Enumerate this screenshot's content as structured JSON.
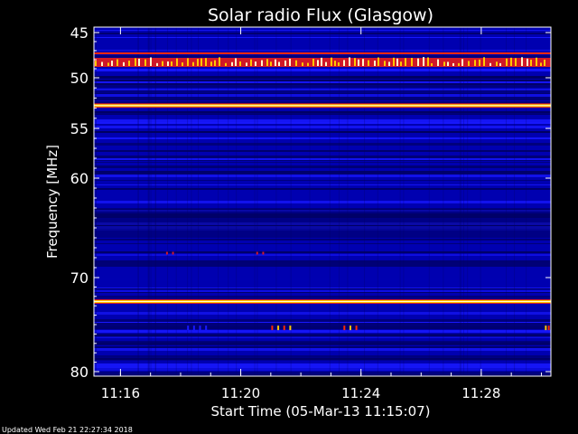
{
  "updated_text": "Updated Wed Feb 21 22:27:34 2018",
  "chart_data": {
    "type": "heatmap",
    "title": "Solar radio Flux (Glasgow)",
    "xlabel": "Start Time (05-Mar-13 11:15:07)",
    "ylabel": "Frequency [MHz]",
    "x_start": "11:15:07",
    "x_ticks": [
      "11:16",
      "11:20",
      "11:24",
      "11:28"
    ],
    "x_tick_minutes": [
      0.883,
      4.883,
      8.883,
      12.883
    ],
    "x_range_minutes": [
      0,
      15.2
    ],
    "y_ticks": [
      45,
      50,
      55,
      60,
      70,
      80
    ],
    "ylim": [
      44.7,
      80.3
    ],
    "y_axis_inverted": true,
    "y_axis_nonlinear": true,
    "colormap": [
      "#000060",
      "#0000b0",
      "#1818ff",
      "#d01828",
      "#ff2800",
      "#ffc800",
      "#fff8d0"
    ],
    "background_level": "blue",
    "features": [
      {
        "name": "dashed spike band",
        "freq_range_mhz": [
          47.8,
          48.6
        ],
        "intensity": "yellow spikes"
      },
      {
        "name": "bright line",
        "freq_mhz": 47.3,
        "intensity": "red"
      },
      {
        "name": "bright line",
        "freq_mhz": 52.7,
        "intensity": "yellow"
      },
      {
        "name": "bright line",
        "freq_mhz": 72.5,
        "intensity": "yellow"
      },
      {
        "name": "spotty band",
        "freq_mhz": 75.3,
        "intensity": "red/blue spots"
      },
      {
        "name": "faint red dots",
        "freq_mhz": 67.5,
        "intensity": "red"
      }
    ]
  }
}
